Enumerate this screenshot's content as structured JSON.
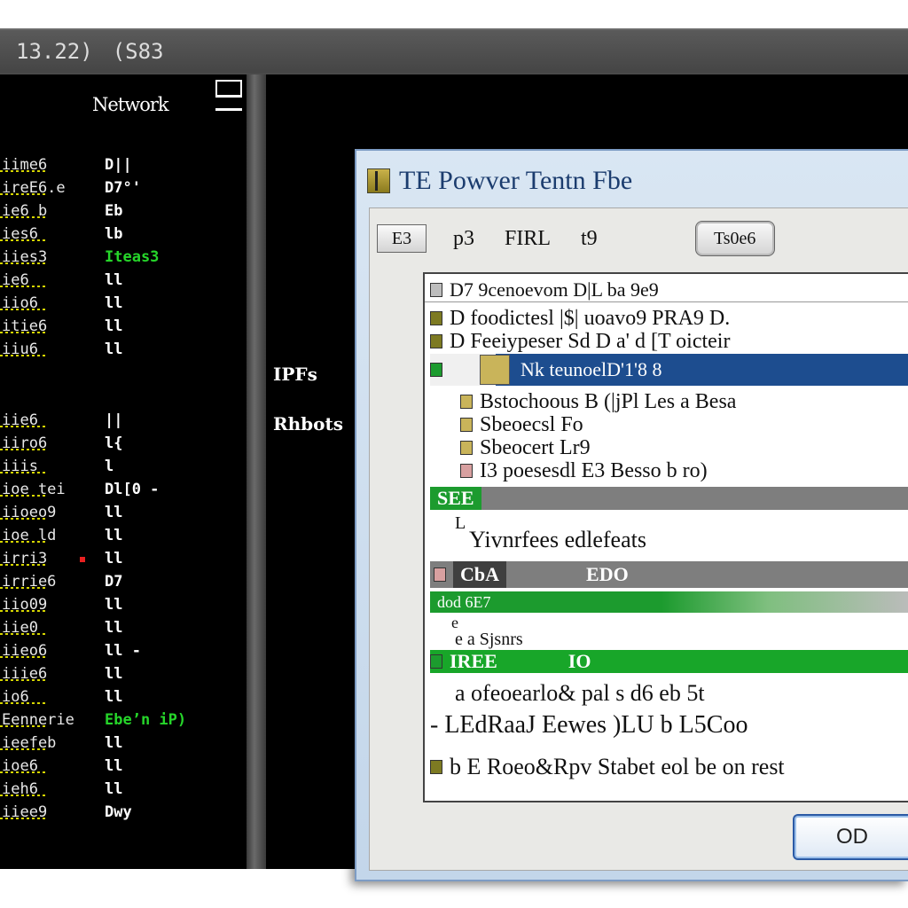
{
  "console": {
    "title_left": "13.22)",
    "title_right": "(S83",
    "pane_header": "Network",
    "right_labels": [
      "IPFs",
      "Rhbots"
    ],
    "rows": [
      {
        "k": "iime6",
        "v": "D||",
        "green": false
      },
      {
        "k": "ireE6.e",
        "v": "D7°'",
        "green": false
      },
      {
        "k": "ie6 b",
        "v": "Eb",
        "green": false
      },
      {
        "k": "ies6",
        "v": "lb",
        "green": false
      },
      {
        "k": "iies3",
        "v": "Iteas3",
        "green": true
      },
      {
        "k": "ie6",
        "v": "ll",
        "green": false
      },
      {
        "k": "iio6",
        "v": "ll",
        "green": false
      },
      {
        "k": "itie6",
        "v": "ll",
        "green": false
      },
      {
        "k": "iiu6",
        "v": "ll",
        "green": false
      },
      {
        "k": "iie6",
        "v": "||",
        "green": false
      },
      {
        "k": "iiro6",
        "v": "l{",
        "green": false
      },
      {
        "k": "iiis",
        "v": "l",
        "green": false
      },
      {
        "k": "ioe tei",
        "v": "Dl[0 -",
        "green": false
      },
      {
        "k": "iioeo9",
        "v": "ll",
        "green": false
      },
      {
        "k": "ioe ld",
        "v": "ll",
        "green": false
      },
      {
        "k": "irri3",
        "v": "ll",
        "green": false
      },
      {
        "k": "irrie6",
        "v": "D7",
        "green": false
      },
      {
        "k": "iio09",
        "v": "ll",
        "green": false
      },
      {
        "k": "iie0",
        "v": "ll",
        "green": false
      },
      {
        "k": "iieo6",
        "v": "ll -",
        "green": false
      },
      {
        "k": "iiie6",
        "v": "ll",
        "green": false
      },
      {
        "k": "io6",
        "v": "ll",
        "green": false
      },
      {
        "k": "Eennerie",
        "v": "Ebe’n iP)",
        "green": true
      },
      {
        "k": "ieefeb",
        "v": "ll",
        "green": false
      },
      {
        "k": "ioe6",
        "v": "ll",
        "green": false
      },
      {
        "k": "ieh6",
        "v": "ll",
        "green": false
      },
      {
        "k": "iiee9",
        "v": "Dwy",
        "green": false
      }
    ]
  },
  "dialog": {
    "title": "TE Powver Tentn Fbe",
    "toolbar": {
      "btn1": "E3",
      "text1": "p3",
      "text2": "FIRL",
      "text3": "t9",
      "btn2": "Ts0e6"
    },
    "list": {
      "header": "D7 9cenoevom  D|L  ba  9e9",
      "row1": "D  foodictesl  |$|  uoavo9  PRA9 D.",
      "row2": "D  Feeiypeser  Sd  D  a'  d  [T  oicteir",
      "selected": "Nk teunoelD'1'8   8",
      "sub1": "Bstochoous  B   (|jPl  Les  a  Besa",
      "sub2": "Sbeoecsl  Fo",
      "sub3": "Sbeocert  Lr9",
      "sub4": "I3  poesesdl  E3  Besso b ro)",
      "bar1_green": "SEE",
      "line_a": "L",
      "line_b": "Yivnrfees  edlefeats",
      "bar2_green": "CbA",
      "bar2_text": "EDO",
      "bar3": "dod  6E7",
      "line_c": "e",
      "line_d": "e  a Sjsnrs",
      "bar4_green": "IREE",
      "bar4_text": "IO",
      "line_e": "a  ofeoearlo&  pal  s  d6  eb  5t",
      "line_f": "- LEdRaaJ  Eewes  )LU  b  L5Coo",
      "line_g": "b  E  Roeo&Rpv  Stabet  eol  be  on  rest"
    },
    "ok_label": "OD"
  },
  "colors": {
    "selection": "#1d4d8f",
    "green": "#1c9b2e",
    "dialog_bg": "#d9e6f3"
  }
}
